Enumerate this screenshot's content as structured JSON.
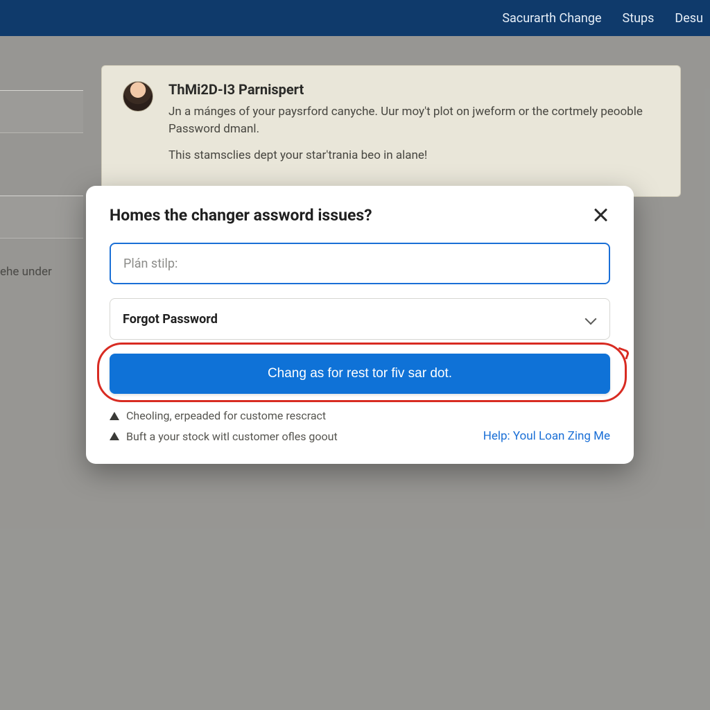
{
  "colors": {
    "navbar_bg": "#0f3a6b",
    "primary": "#0f72d7",
    "input_focus_border": "#1a6fd6",
    "highlight_ring": "#d82b22"
  },
  "topnav": {
    "items": [
      "Sacurarth Change",
      "Stups",
      "Desu"
    ]
  },
  "sidebar": {
    "partial_label": "ehe under"
  },
  "background_card": {
    "title": "ThMi2D-I3 Parnispert",
    "line1": "Jn a mánges of your paysrford canyche. Uur moy't plot on jweform or the cortmely peooble Password dmanl.",
    "line2": "This stamsclies dept your star'trania beo in alane!"
  },
  "modal": {
    "title": "Homes the changer assword issues?",
    "input_placeholder": "Plán stilp:",
    "select_value": "Forgot Password",
    "primary_button": "Chang as for rest tor fiv sar dot.",
    "notes": [
      "Cheoling, erpeaded for custome rescract",
      "Buft a your stock witl customer ofles goout"
    ],
    "help_link": "Help: Youl Loan Zing Me"
  }
}
